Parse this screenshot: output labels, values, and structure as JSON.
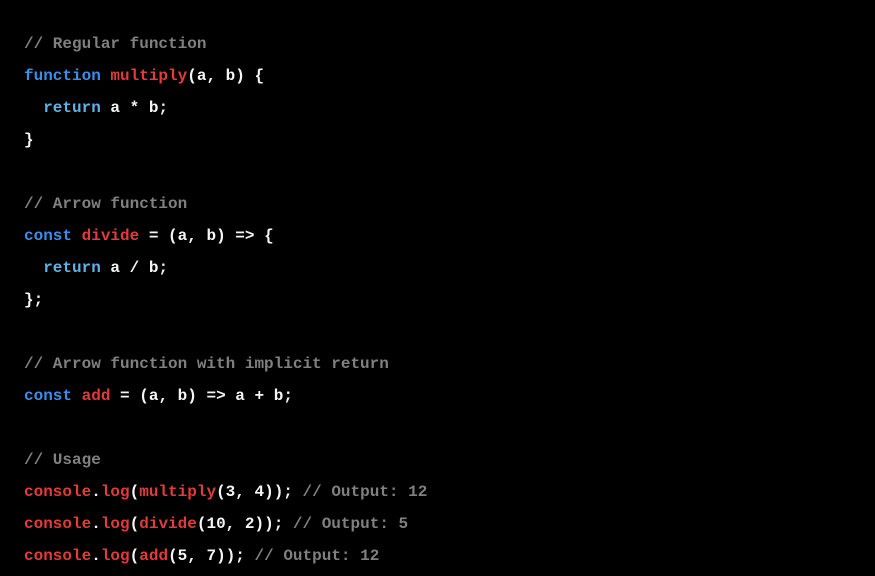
{
  "tokens": [
    {
      "cls": "tk-comment",
      "t": "// Regular function"
    },
    {
      "cls": "newline",
      "t": "\n"
    },
    {
      "cls": "tk-keyword",
      "t": "function"
    },
    {
      "cls": "tk-punct",
      "t": " "
    },
    {
      "cls": "tk-funcname",
      "t": "multiply"
    },
    {
      "cls": "tk-punct",
      "t": "("
    },
    {
      "cls": "tk-param",
      "t": "a"
    },
    {
      "cls": "tk-punct",
      "t": ", "
    },
    {
      "cls": "tk-param",
      "t": "b"
    },
    {
      "cls": "tk-punct",
      "t": ") {"
    },
    {
      "cls": "newline",
      "t": "\n"
    },
    {
      "cls": "tk-punct",
      "t": "  "
    },
    {
      "cls": "tk-return",
      "t": "return"
    },
    {
      "cls": "tk-punct",
      "t": " "
    },
    {
      "cls": "tk-param",
      "t": "a"
    },
    {
      "cls": "tk-op",
      "t": " * "
    },
    {
      "cls": "tk-param",
      "t": "b"
    },
    {
      "cls": "tk-punct",
      "t": ";"
    },
    {
      "cls": "newline",
      "t": "\n"
    },
    {
      "cls": "tk-punct",
      "t": "}"
    },
    {
      "cls": "newline",
      "t": "\n"
    },
    {
      "cls": "newline",
      "t": "\n"
    },
    {
      "cls": "tk-comment",
      "t": "// Arrow function"
    },
    {
      "cls": "newline",
      "t": "\n"
    },
    {
      "cls": "tk-keyword",
      "t": "const"
    },
    {
      "cls": "tk-punct",
      "t": " "
    },
    {
      "cls": "tk-funcname",
      "t": "divide"
    },
    {
      "cls": "tk-op",
      "t": " = "
    },
    {
      "cls": "tk-punct",
      "t": "("
    },
    {
      "cls": "tk-param",
      "t": "a"
    },
    {
      "cls": "tk-punct",
      "t": ", "
    },
    {
      "cls": "tk-param",
      "t": "b"
    },
    {
      "cls": "tk-punct",
      "t": ") "
    },
    {
      "cls": "tk-op",
      "t": "=>"
    },
    {
      "cls": "tk-punct",
      "t": " {"
    },
    {
      "cls": "newline",
      "t": "\n"
    },
    {
      "cls": "tk-punct",
      "t": "  "
    },
    {
      "cls": "tk-return",
      "t": "return"
    },
    {
      "cls": "tk-punct",
      "t": " "
    },
    {
      "cls": "tk-param",
      "t": "a"
    },
    {
      "cls": "tk-op",
      "t": " / "
    },
    {
      "cls": "tk-param",
      "t": "b"
    },
    {
      "cls": "tk-punct",
      "t": ";"
    },
    {
      "cls": "newline",
      "t": "\n"
    },
    {
      "cls": "tk-punct",
      "t": "};"
    },
    {
      "cls": "newline",
      "t": "\n"
    },
    {
      "cls": "newline",
      "t": "\n"
    },
    {
      "cls": "tk-comment",
      "t": "// Arrow function with implicit return"
    },
    {
      "cls": "newline",
      "t": "\n"
    },
    {
      "cls": "tk-keyword",
      "t": "const"
    },
    {
      "cls": "tk-punct",
      "t": " "
    },
    {
      "cls": "tk-funcname",
      "t": "add"
    },
    {
      "cls": "tk-op",
      "t": " = "
    },
    {
      "cls": "tk-punct",
      "t": "("
    },
    {
      "cls": "tk-param",
      "t": "a"
    },
    {
      "cls": "tk-punct",
      "t": ", "
    },
    {
      "cls": "tk-param",
      "t": "b"
    },
    {
      "cls": "tk-punct",
      "t": ") "
    },
    {
      "cls": "tk-op",
      "t": "=>"
    },
    {
      "cls": "tk-punct",
      "t": " "
    },
    {
      "cls": "tk-param",
      "t": "a"
    },
    {
      "cls": "tk-op",
      "t": " + "
    },
    {
      "cls": "tk-param",
      "t": "b"
    },
    {
      "cls": "tk-punct",
      "t": ";"
    },
    {
      "cls": "newline",
      "t": "\n"
    },
    {
      "cls": "newline",
      "t": "\n"
    },
    {
      "cls": "tk-comment",
      "t": "// Usage"
    },
    {
      "cls": "newline",
      "t": "\n"
    },
    {
      "cls": "tk-ident",
      "t": "console"
    },
    {
      "cls": "tk-punct",
      "t": "."
    },
    {
      "cls": "tk-funcname",
      "t": "log"
    },
    {
      "cls": "tk-punct",
      "t": "("
    },
    {
      "cls": "tk-funcname",
      "t": "multiply"
    },
    {
      "cls": "tk-punct",
      "t": "("
    },
    {
      "cls": "tk-number",
      "t": "3"
    },
    {
      "cls": "tk-punct",
      "t": ", "
    },
    {
      "cls": "tk-number",
      "t": "4"
    },
    {
      "cls": "tk-punct",
      "t": "));"
    },
    {
      "cls": "tk-comment",
      "t": " // Output: 12"
    },
    {
      "cls": "newline",
      "t": "\n"
    },
    {
      "cls": "tk-ident",
      "t": "console"
    },
    {
      "cls": "tk-punct",
      "t": "."
    },
    {
      "cls": "tk-funcname",
      "t": "log"
    },
    {
      "cls": "tk-punct",
      "t": "("
    },
    {
      "cls": "tk-funcname",
      "t": "divide"
    },
    {
      "cls": "tk-punct",
      "t": "("
    },
    {
      "cls": "tk-number",
      "t": "10"
    },
    {
      "cls": "tk-punct",
      "t": ", "
    },
    {
      "cls": "tk-number",
      "t": "2"
    },
    {
      "cls": "tk-punct",
      "t": "));"
    },
    {
      "cls": "tk-comment",
      "t": " // Output: 5"
    },
    {
      "cls": "newline",
      "t": "\n"
    },
    {
      "cls": "tk-ident",
      "t": "console"
    },
    {
      "cls": "tk-punct",
      "t": "."
    },
    {
      "cls": "tk-funcname",
      "t": "log"
    },
    {
      "cls": "tk-punct",
      "t": "("
    },
    {
      "cls": "tk-funcname",
      "t": "add"
    },
    {
      "cls": "tk-punct",
      "t": "("
    },
    {
      "cls": "tk-number",
      "t": "5"
    },
    {
      "cls": "tk-punct",
      "t": ", "
    },
    {
      "cls": "tk-number",
      "t": "7"
    },
    {
      "cls": "tk-punct",
      "t": "));"
    },
    {
      "cls": "tk-comment",
      "t": " // Output: 12"
    }
  ]
}
